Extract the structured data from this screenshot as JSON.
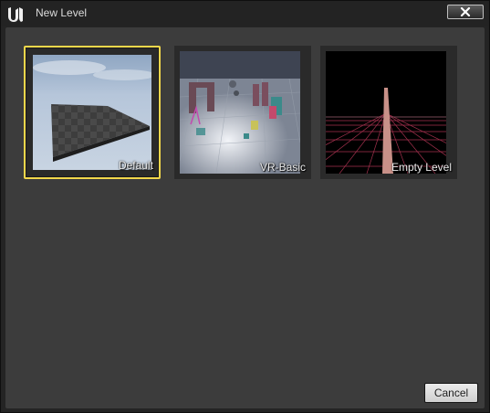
{
  "window": {
    "title": "New Level",
    "logo_icon": "unreal-engine-logo",
    "close_icon": "close-x-icon"
  },
  "templates": [
    {
      "label": "Default",
      "selected": true
    },
    {
      "label": "VR-Basic",
      "selected": false
    },
    {
      "label": "Empty Level",
      "selected": false
    }
  ],
  "footer": {
    "cancel_label": "Cancel"
  },
  "colors": {
    "selection_border": "#f2d74b",
    "panel_background": "#3c3c3c",
    "titlebar_background": "#232323"
  }
}
